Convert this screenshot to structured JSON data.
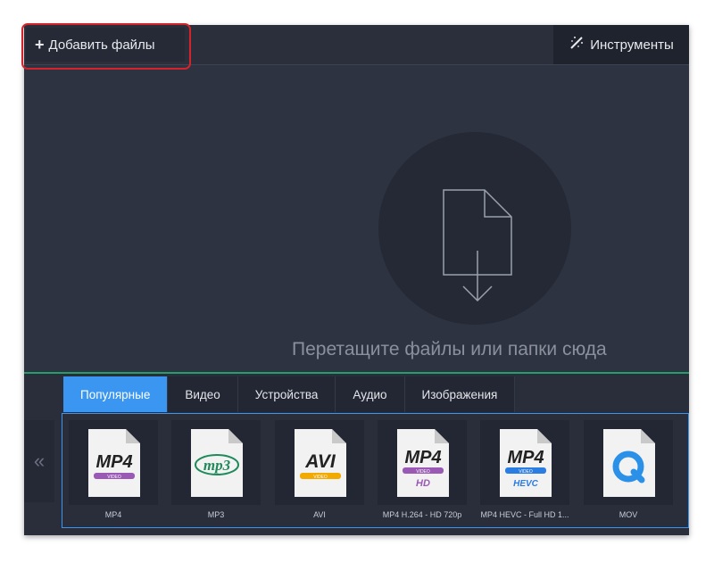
{
  "toolbar": {
    "add_files_label": "Добавить файлы",
    "tools_label": "Инструменты"
  },
  "dropzone": {
    "hint": "Перетащите файлы или папки сюда"
  },
  "tabs": [
    {
      "label": "Популярные",
      "active": true
    },
    {
      "label": "Видео",
      "active": false
    },
    {
      "label": "Устройства",
      "active": false
    },
    {
      "label": "Аудио",
      "active": false
    },
    {
      "label": "Изображения",
      "active": false
    }
  ],
  "collapse_glyph": "«",
  "formats": [
    {
      "label": "MP4",
      "badge_top": "MP4",
      "stripe_text": "VIDEO",
      "stripe_color": "#9b59b6",
      "sub": ""
    },
    {
      "label": "MP3",
      "badge_top": "mp3",
      "stripe_text": "",
      "stripe_color": "",
      "sub": ""
    },
    {
      "label": "AVI",
      "badge_top": "AVI",
      "stripe_text": "VIDEO",
      "stripe_color": "#f2a900",
      "sub": ""
    },
    {
      "label": "MP4 H.264 - HD 720p",
      "badge_top": "MP4",
      "stripe_text": "VIDEO",
      "stripe_color": "#9b59b6",
      "sub": "HD"
    },
    {
      "label": "MP4 HEVC - Full HD 1...",
      "badge_top": "MP4",
      "stripe_text": "VIDEO",
      "stripe_color": "#2a7de1",
      "sub": "HEVC"
    },
    {
      "label": "MOV",
      "badge_top": "",
      "stripe_text": "",
      "stripe_color": "",
      "sub": ""
    }
  ],
  "colors": {
    "accent": "#3a96f0",
    "highlight": "#d4242b",
    "bottom_border": "#23a06a",
    "mp3_green": "#1f8a5a",
    "quicktime_blue": "#2a90e8"
  }
}
